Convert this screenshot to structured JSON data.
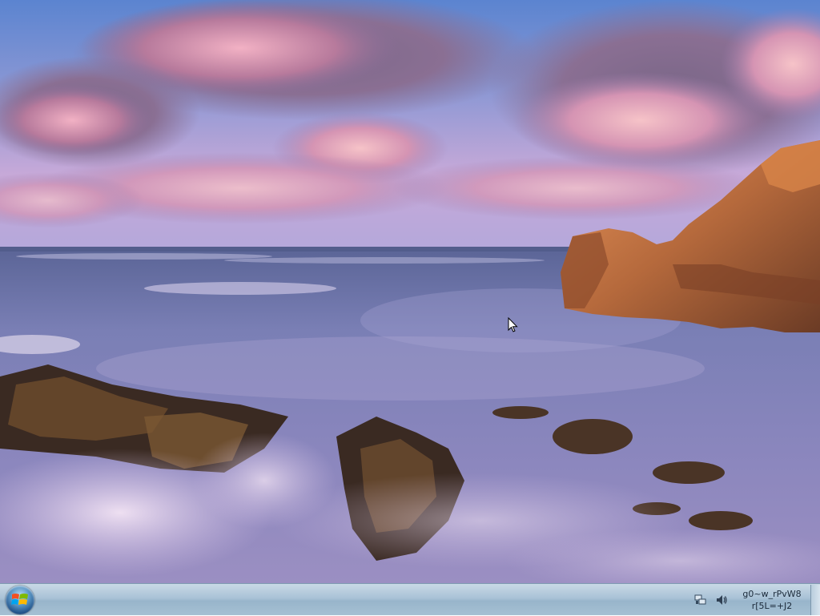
{
  "desktop": {
    "wallpaper": "coastal-sunset-seascape"
  },
  "taskbar": {
    "start_button": "windows-start-orb",
    "tray": {
      "network_icon": "network-icon",
      "volume_icon": "volume-icon",
      "clock_line1": "g0~w_rPvW8",
      "clock_line2": "r[5L=+J2"
    }
  },
  "colors": {
    "taskbar_top": "#c9d9e6",
    "taskbar_bottom": "#a6c0d3",
    "sky_top": "#5b84d0",
    "cloud_pink": "#e6a3bf",
    "sea": "#7d7eb8",
    "rock": "#b5693c"
  }
}
